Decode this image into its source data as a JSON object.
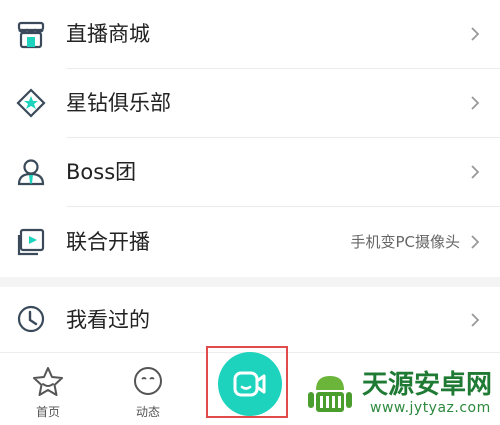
{
  "menu": [
    {
      "label": "直播商城",
      "icon": "storefront-icon",
      "sub": ""
    },
    {
      "label": "星钻俱乐部",
      "icon": "star-diamond-icon",
      "sub": ""
    },
    {
      "label": "Boss团",
      "icon": "boss-team-icon",
      "sub": ""
    },
    {
      "label": "联合开播",
      "icon": "screen-play-icon",
      "sub": "手机变PC摄像头"
    },
    {
      "label": "我看过的",
      "icon": "clock-icon",
      "sub": ""
    }
  ],
  "tabbar": {
    "home_label": "首页",
    "feed_label": "动态"
  },
  "watermark": {
    "title": "天源安卓网",
    "url": "www.jytyaz.com"
  },
  "colors": {
    "accent": "#1ed3bd",
    "highlight": "#e24b4b",
    "icon_stroke": "#3a4a5a"
  }
}
